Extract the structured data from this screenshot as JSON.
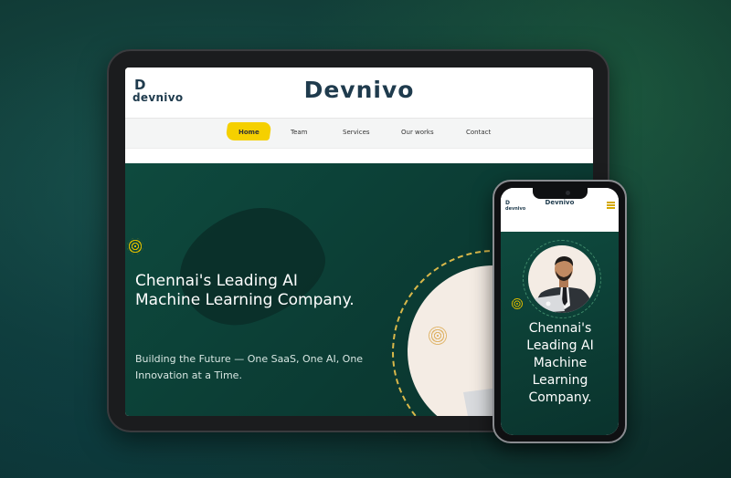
{
  "tablet": {
    "logo": {
      "mark": "D",
      "word": "devnivo"
    },
    "brand": "Devnivo",
    "nav": [
      {
        "label": "Home"
      },
      {
        "label": "Team"
      },
      {
        "label": "Services"
      },
      {
        "label": "Our works"
      },
      {
        "label": "Contact"
      }
    ],
    "hero": {
      "heading": "Chennai's Leading AI Machine Learning Company.",
      "subtext": "Building the Future — One SaaS, One AI, One Innovation at a Time."
    }
  },
  "phone": {
    "logo": "devnivo",
    "brand": "Devnivo",
    "hero": {
      "heading": "Chennai's Leading AI Machine Learning Company."
    }
  },
  "colors": {
    "brand_dark": "#1f3b4d",
    "hero_green": "#0e4a3e",
    "accent_yellow": "#f5d000"
  }
}
